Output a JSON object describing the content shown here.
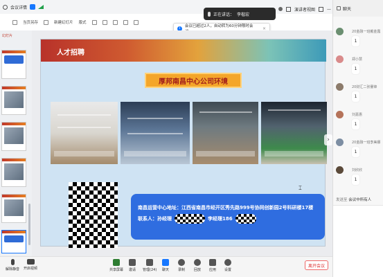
{
  "titlebar": {
    "title": "会议详情"
  },
  "speaker": {
    "label": "正在讲话：",
    "name": "李楷宏"
  },
  "topright": {
    "layout_label": "演讲者视图",
    "chat_label": "聊天"
  },
  "toolbar": {
    "items": [
      "当页另存",
      "新建幻灯片",
      "版式",
      "",
      "",
      "",
      "",
      ""
    ]
  },
  "notice": {
    "text": "会议已超过2人，自动转为60分钟限时会议。",
    "close": "×"
  },
  "thumbs": {
    "panel_label": "幻灯片"
  },
  "slide": {
    "header": "人才招聘",
    "title": "厚邦南昌中心公司环境",
    "address": "南昌运营中心地址：江西省南昌市经开区秀先路999号协同创新园2号科研楼17楼",
    "contact_label": "联系人：孙经理",
    "contact2_label": "李经理186"
  },
  "chat": {
    "messages": [
      {
        "name": "20金融一班戴金露",
        "text": "1",
        "color": "#6b8f71"
      },
      {
        "name": "郑小慧",
        "text": "1",
        "color": "#d98b8b"
      },
      {
        "name": "20财汇二张謇锋",
        "text": "1",
        "color": "#8c7b6b"
      },
      {
        "name": "刘嘉惠",
        "text": "1",
        "color": "#b5735a"
      },
      {
        "name": "20金融一班李美娜",
        "text": "1",
        "color": "#7d8ea3"
      },
      {
        "name": "刘欣欣",
        "text": "1",
        "color": "#5b4a3a"
      }
    ],
    "sendto_label": "发送至",
    "sendto_target": "会议中所有人"
  },
  "bottombar": {
    "items": [
      {
        "label": "解除静音",
        "icon": "mic-icon"
      },
      {
        "label": "开启视频",
        "icon": "camera-icon"
      },
      {
        "label": "共享屏幕",
        "icon": "share-screen-icon"
      },
      {
        "label": "邀请",
        "icon": "invite-icon"
      },
      {
        "label": "管理(24)",
        "icon": "members-icon"
      },
      {
        "label": "聊天",
        "icon": "chat-icon"
      },
      {
        "label": "录制",
        "icon": "record-icon"
      },
      {
        "label": "回放",
        "icon": "replay-icon"
      },
      {
        "label": "应用",
        "icon": "apps-icon"
      },
      {
        "label": "设置",
        "icon": "settings-icon"
      }
    ],
    "leave_label": "离开会议"
  }
}
